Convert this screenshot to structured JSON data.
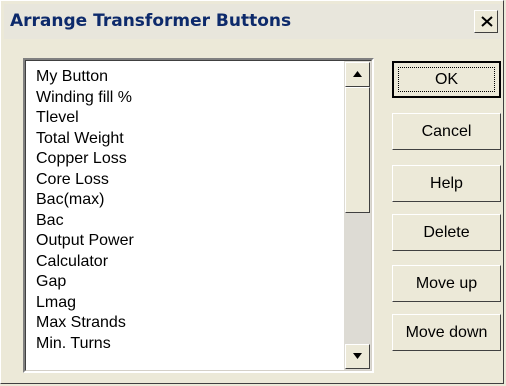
{
  "window": {
    "title": "Arrange Transformer Buttons"
  },
  "titlebar": {
    "close_icon": "close-icon"
  },
  "list": {
    "items": [
      "My Button",
      "Winding fill %",
      "Tlevel",
      "Total Weight",
      "Copper Loss",
      "Core Loss",
      "Bac(max)",
      "Bac",
      "Output Power",
      "Calculator",
      "Gap",
      "Lmag",
      "Max Strands",
      "Min. Turns"
    ],
    "scroll_position": 0
  },
  "buttons": {
    "ok": "OK",
    "cancel": "Cancel",
    "help": "Help",
    "delete": "Delete",
    "move_up": "Move up",
    "move_down": "Move down"
  },
  "colors": {
    "title_text": "#0d2a6b",
    "face": "#ece9d8"
  }
}
